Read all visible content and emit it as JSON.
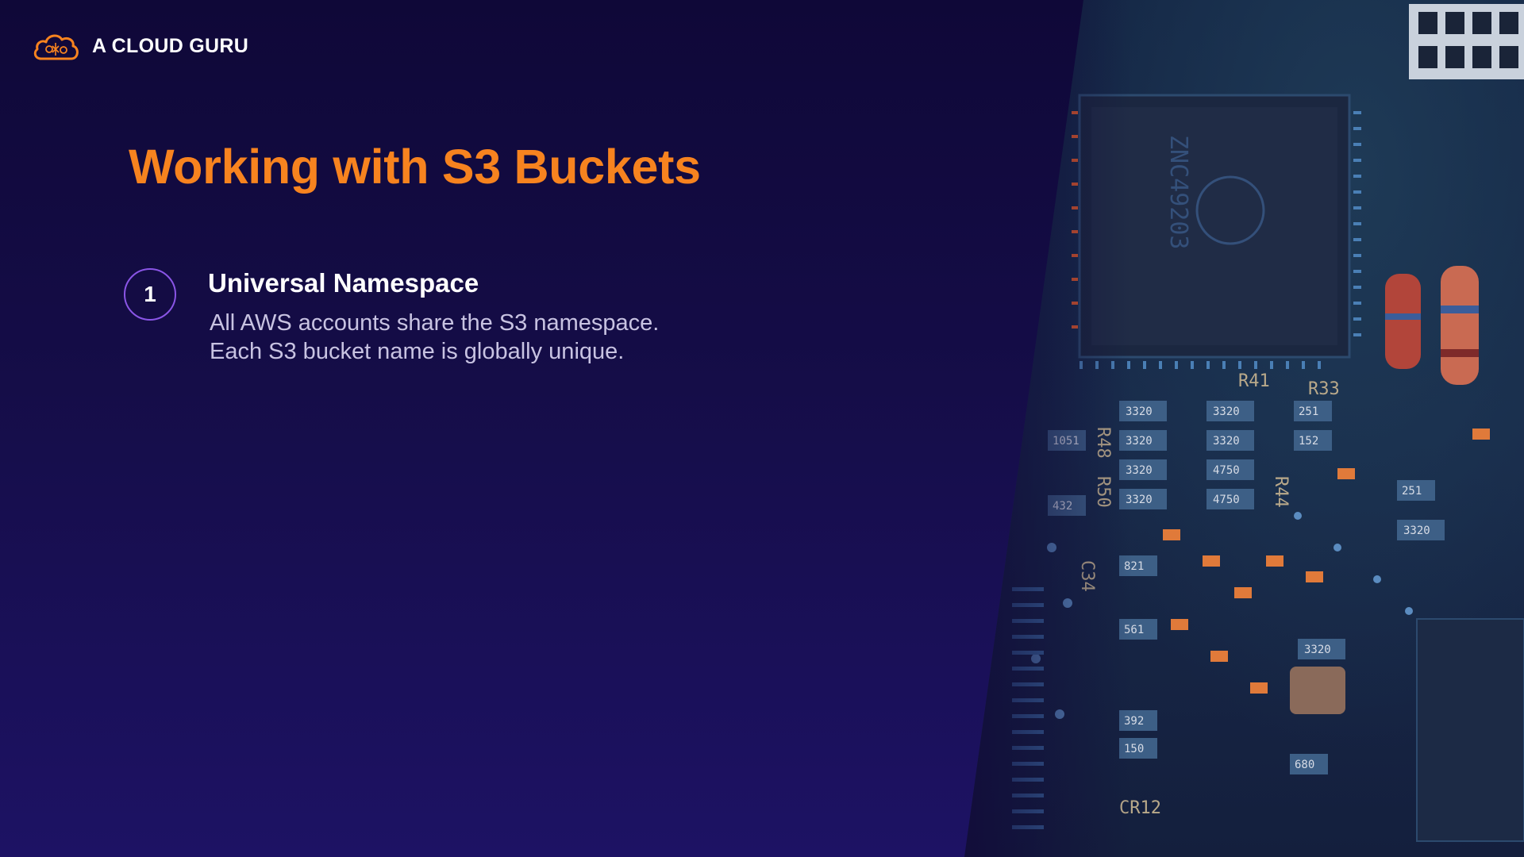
{
  "brand": {
    "name": "A CLOUD GURU",
    "logo_icon": "cloud-logo-icon",
    "accent_color": "#f7831f"
  },
  "slide": {
    "title": "Working with S3 Buckets",
    "items": [
      {
        "number": "1",
        "heading": "Universal Namespace",
        "lines": [
          "All AWS accounts share the S3 namespace.",
          "Each S3 bucket name is globally unique."
        ]
      }
    ]
  },
  "image": {
    "name": "circuit-board-photo"
  },
  "colors": {
    "background": "#150d48",
    "title": "#f7831f",
    "badge_border": "#8a55e6",
    "body_text": "#c8c3e2"
  }
}
